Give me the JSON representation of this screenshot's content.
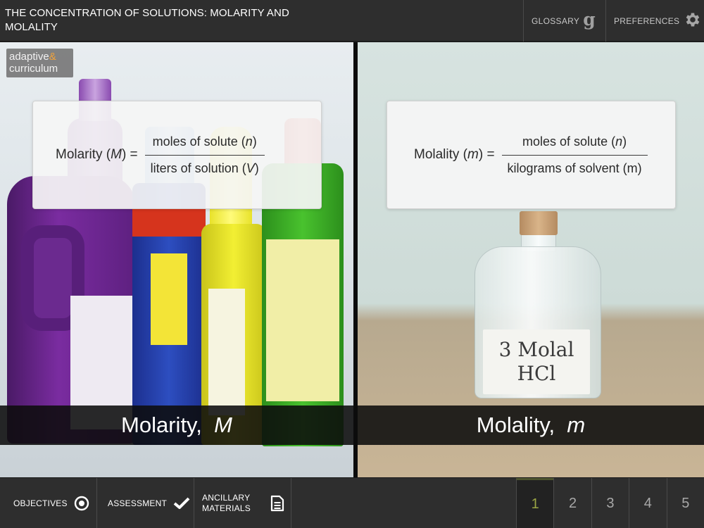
{
  "header": {
    "title": "THE CONCENTRATION OF SOLUTIONS: MOLARITY AND MOLALITY",
    "glossary_label": "GLOSSARY",
    "glossary_glyph": "g",
    "preferences_label": "PREFERENCES"
  },
  "logo": {
    "line1": "adaptive",
    "line1_mark": "&",
    "line2": "curriculum"
  },
  "left_panel": {
    "formula_lhs_prefix": "Molarity (",
    "formula_lhs_var": "M",
    "formula_lhs_suffix": ") =",
    "numerator_text": "moles of solute (",
    "numerator_var": "n",
    "numerator_close": ")",
    "denominator_text": "liters of solution (",
    "denominator_var": "V",
    "denominator_close": ")",
    "caption_text": "Molarity, ",
    "caption_var": "M"
  },
  "right_panel": {
    "formula_lhs_prefix": "Molality (",
    "formula_lhs_var": "m",
    "formula_lhs_suffix": ") =",
    "numerator_text": "moles of solute (",
    "numerator_var": "n",
    "numerator_close": ")",
    "denominator_text": "kilograms of solvent (m)",
    "flask_label_line1": "3 Molal",
    "flask_label_line2": "HCl",
    "caption_text": "Molality, ",
    "caption_var": "m"
  },
  "footer": {
    "objectives_label": "OBJECTIVES",
    "assessment_label": "ASSESSMENT",
    "ancillary_line1": "ANCILLARY",
    "ancillary_line2": "MATERIALS",
    "pages": [
      "1",
      "2",
      "3",
      "4",
      "5"
    ],
    "active_page": "1"
  },
  "colors": {
    "bar_background": "#2e2e2e",
    "active_page_text": "#9aa544",
    "logo_accent": "#f0a23a"
  },
  "icons": {
    "glossary": "glossary-g-icon",
    "preferences": "gear-icon",
    "objectives": "target-icon",
    "assessment": "checkmark-icon",
    "ancillary": "document-icon"
  }
}
